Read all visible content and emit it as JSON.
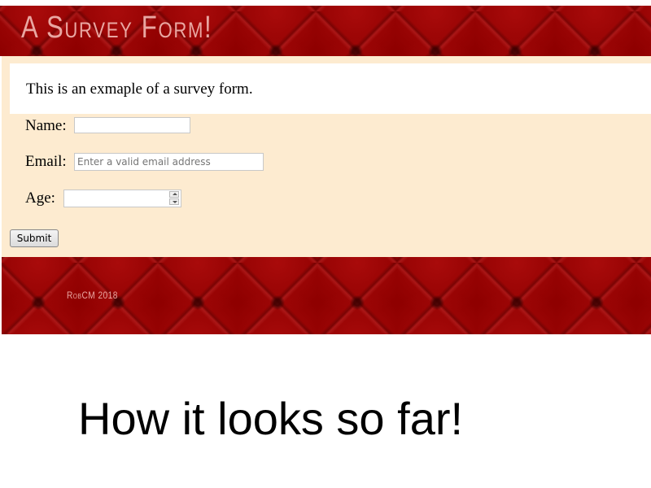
{
  "header": {
    "title": "A Survey Form!"
  },
  "intro": {
    "text": "This is an exmaple of a survey form."
  },
  "form": {
    "name_label": "Name:",
    "name_value": "",
    "email_label": "Email:",
    "email_placeholder": "Enter a valid email address",
    "email_value": "",
    "age_label": "Age:",
    "age_value": "",
    "submit_label": "Submit"
  },
  "footer": {
    "text": "RobCM 2018"
  },
  "caption": {
    "text": "How it looks so far!"
  },
  "colors": {
    "banner_red": "#8f0000",
    "form_background": "#fdebd0",
    "title_pink": "#e9a7a2"
  }
}
